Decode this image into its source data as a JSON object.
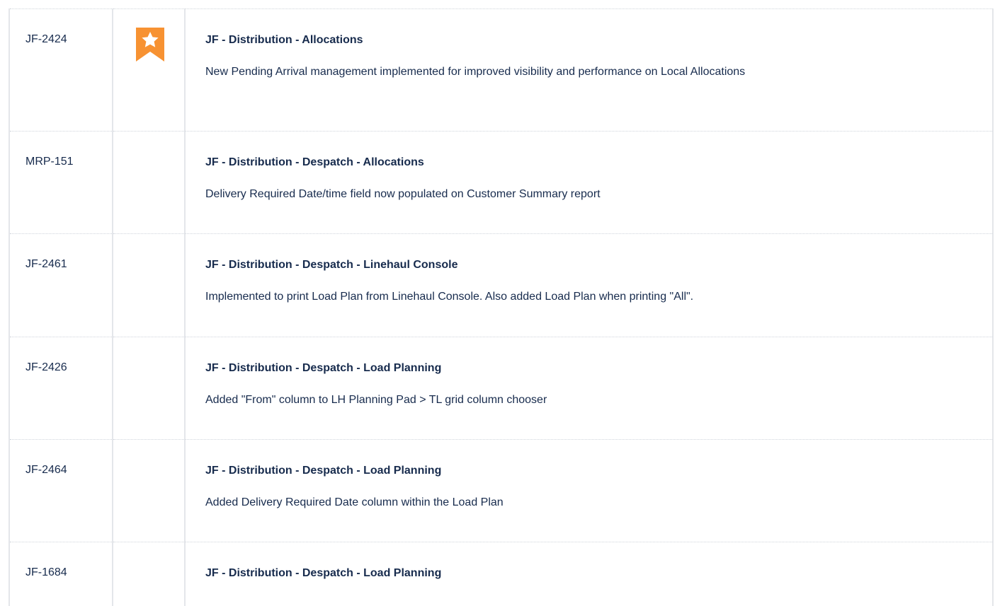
{
  "colors": {
    "bookmark": "#f79232",
    "text": "#172b4d",
    "grid": "#cfd4db"
  },
  "rows": [
    {
      "id": "JF-2424",
      "flag_icon": "star-bookmark-icon",
      "title": "JF - Distribution - Allocations",
      "description": "New Pending Arrival management implemented for improved visibility and performance on Local Allocations"
    },
    {
      "id": "MRP-151",
      "flag_icon": "",
      "title": "JF - Distribution - Despatch - Allocations",
      "description": "Delivery Required Date/time field now populated on Customer Summary report"
    },
    {
      "id": "JF-2461",
      "flag_icon": "",
      "title": "JF - Distribution - Despatch - Linehaul Console",
      "description": "Implemented to print Load Plan from Linehaul Console. Also added Load Plan when printing \"All\"."
    },
    {
      "id": "JF-2426",
      "flag_icon": "",
      "title": "JF - Distribution - Despatch - Load Planning",
      "description": "Added \"From\" column to LH Planning Pad > TL grid column chooser"
    },
    {
      "id": "JF-2464",
      "flag_icon": "",
      "title": "JF - Distribution - Despatch - Load Planning",
      "description": "Added Delivery Required Date column within the Load Plan"
    },
    {
      "id": "JF-1684",
      "flag_icon": "",
      "title": "JF - Distribution - Despatch - Load Planning",
      "description": ""
    }
  ]
}
